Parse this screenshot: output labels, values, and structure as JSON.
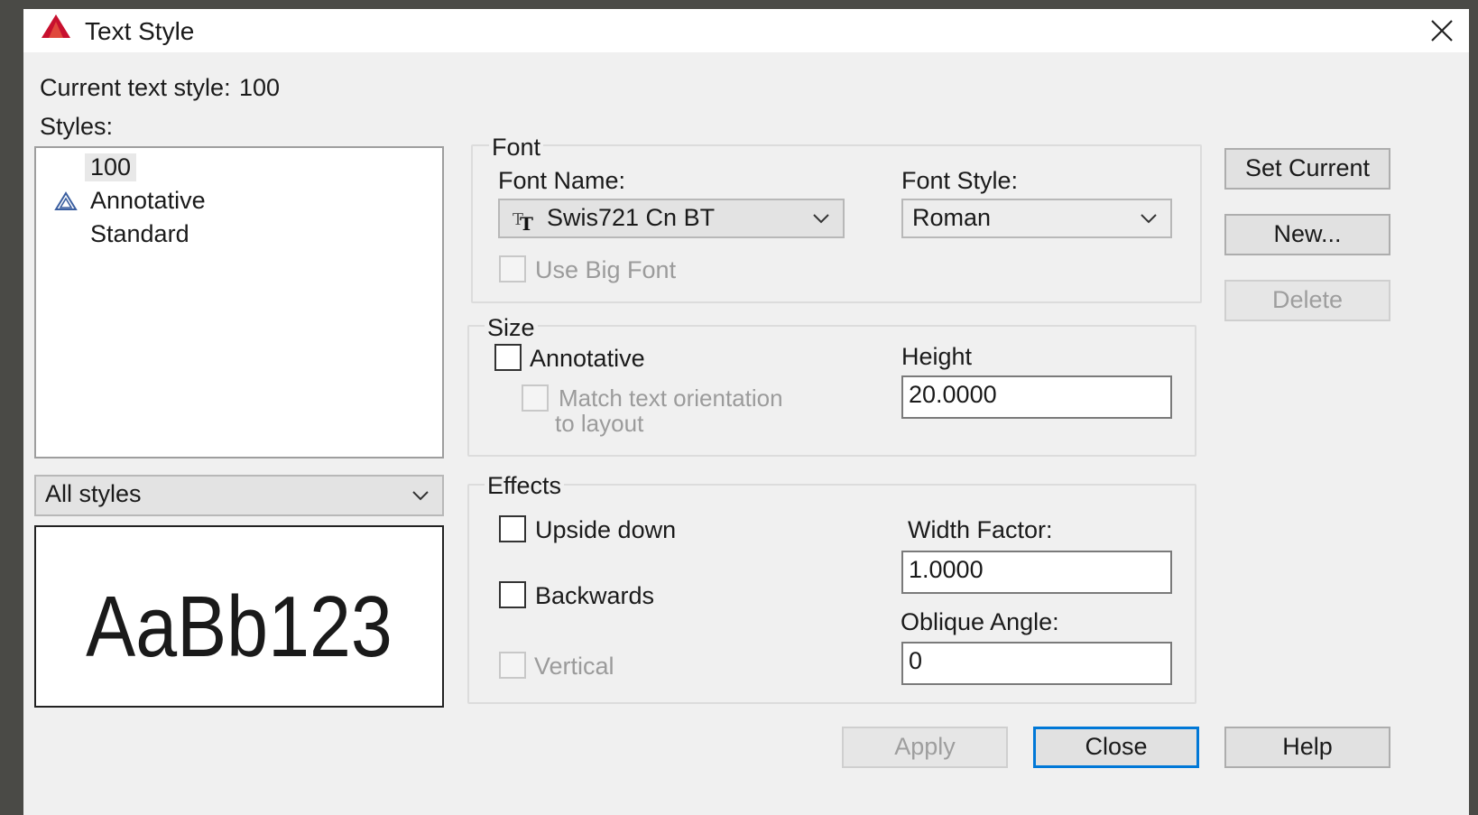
{
  "window": {
    "title": "Text Style"
  },
  "current_style": {
    "label": "Current text style:",
    "value": "100"
  },
  "styles": {
    "label": "Styles:",
    "items": [
      {
        "label": "100",
        "selected": true,
        "icon": null
      },
      {
        "label": "Annotative",
        "selected": false,
        "icon": "annotative-icon"
      },
      {
        "label": "Standard",
        "selected": false,
        "icon": null
      }
    ],
    "filter": "All styles"
  },
  "preview": {
    "text": "AaBb123"
  },
  "font_group": {
    "title": "Font",
    "font_name_label": "Font Name:",
    "font_name_value": "Swis721 Cn BT",
    "font_style_label": "Font Style:",
    "font_style_value": "Roman",
    "big_font_label": "Use Big Font"
  },
  "size_group": {
    "title": "Size",
    "annotative_label": "Annotative",
    "match_line1": "Match text orientation",
    "match_line2": "to layout",
    "height_label": "Height",
    "height_value": "20.0000"
  },
  "effects_group": {
    "title": "Effects",
    "upside_down_label": "Upside down",
    "backwards_label": "Backwards",
    "vertical_label": "Vertical",
    "width_factor_label": "Width Factor:",
    "width_factor_value": "1.0000",
    "oblique_label": "Oblique Angle:",
    "oblique_value": "0"
  },
  "buttons": {
    "set_current": "Set Current",
    "new": "New...",
    "delete": "Delete",
    "apply": "Apply",
    "close": "Close",
    "help": "Help"
  },
  "colors": {
    "accent": "#0078d7",
    "app_icon": "#c8102e"
  }
}
